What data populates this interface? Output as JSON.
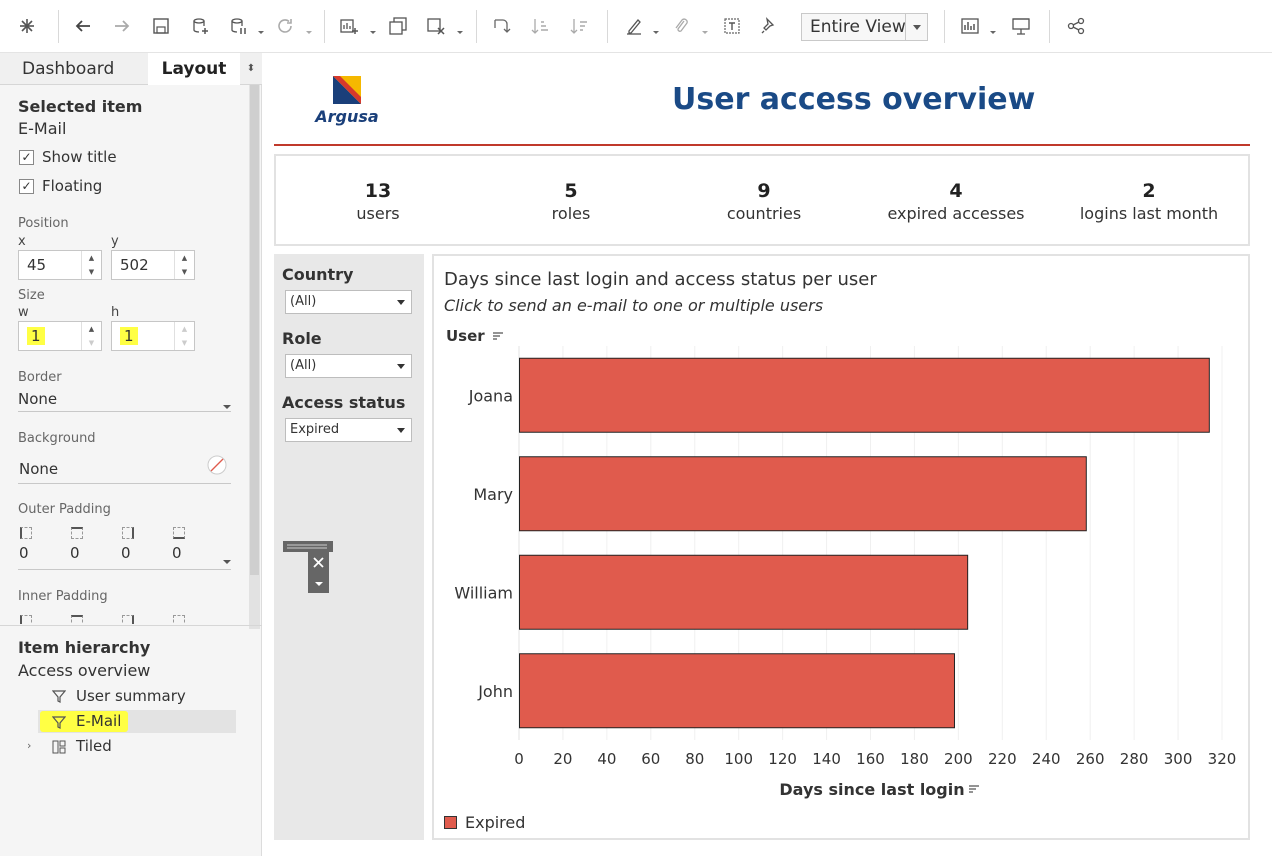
{
  "toolbar": {
    "view_select": "Entire View"
  },
  "left_pane": {
    "tabs": {
      "dashboard": "Dashboard",
      "layout": "Layout"
    },
    "selected_item_label": "Selected item",
    "selected_item_value": "E-Mail",
    "show_title": "Show title",
    "floating": "Floating",
    "position_label": "Position",
    "x_label": "x",
    "x_value": "45",
    "y_label": "y",
    "y_value": "502",
    "size_label": "Size",
    "w_label": "w",
    "w_value": "1",
    "h_label": "h",
    "h_value": "1",
    "border_label": "Border",
    "border_value": "None",
    "background_label": "Background",
    "background_value": "None",
    "outer_padding_label": "Outer Padding",
    "outer_padding_values": [
      "0",
      "0",
      "0",
      "0"
    ],
    "inner_padding_label": "Inner Padding",
    "hierarchy_label": "Item hierarchy",
    "hierarchy_root": "Access overview",
    "hierarchy_items": [
      "User summary",
      "E-Mail",
      "Tiled"
    ]
  },
  "dashboard": {
    "logo_text": "Argusa",
    "title": "User access overview",
    "kpis": [
      {
        "value": "13",
        "label": "users"
      },
      {
        "value": "5",
        "label": "roles"
      },
      {
        "value": "9",
        "label": "countries"
      },
      {
        "value": "4",
        "label": "expired accesses"
      },
      {
        "value": "2",
        "label": "logins last month"
      }
    ],
    "filters": [
      {
        "label": "Country",
        "value": "(All)"
      },
      {
        "label": "Role",
        "value": "(All)"
      },
      {
        "label": "Access status",
        "value": "Expired"
      }
    ],
    "chart_header": {
      "title": "Days since last login and access status per user",
      "subtitle": "Click to send an e-mail to one or multiple users",
      "ylabel": "User"
    }
  },
  "chart_data": {
    "type": "bar",
    "orientation": "horizontal",
    "categories": [
      "Joana",
      "Mary",
      "William",
      "John"
    ],
    "series": [
      {
        "name": "Expired",
        "values": [
          314,
          258,
          204,
          198
        ]
      }
    ],
    "xlabel": "Days since last login",
    "ylabel": "User",
    "xlim": [
      0,
      320
    ],
    "xticks": [
      0,
      20,
      40,
      60,
      80,
      100,
      120,
      140,
      160,
      180,
      200,
      220,
      240,
      260,
      280,
      300,
      320
    ],
    "grid": "vertical",
    "legend": "bottom-left",
    "colors": {
      "Expired": "#e05b4d"
    }
  }
}
